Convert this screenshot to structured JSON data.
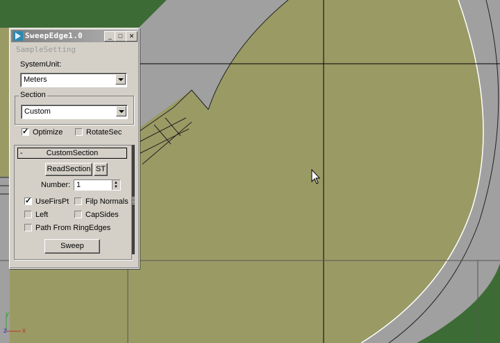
{
  "window": {
    "title": "SweepEdge1.0",
    "menu": "SampleSetting",
    "buttons": {
      "minimize": "_",
      "maximize": "□",
      "close": "✕"
    }
  },
  "system_unit": {
    "label": "SystemUnit:",
    "value": "Meters"
  },
  "section": {
    "label": "Section",
    "value": "Custom"
  },
  "options": {
    "optimize": {
      "label": "Optimize",
      "checked": true
    },
    "rotate_sec": {
      "label": "RotateSec",
      "checked": false
    }
  },
  "custom_section": {
    "header": "CustomSection",
    "collapse": "-",
    "read_section": "ReadSection",
    "st": "ST",
    "number_label": "Number:",
    "number_value": "1",
    "use_first_pt": {
      "label": "UseFirsPt",
      "checked": true
    },
    "flip_normals": {
      "label": "Filp Normals",
      "checked": false
    },
    "left": {
      "label": "Left",
      "checked": false
    },
    "cap_sides": {
      "label": "CapSides",
      "checked": false
    },
    "path_from_ring_edges": {
      "label": "Path From RingEdges",
      "checked": false
    },
    "sweep": "Sweep"
  },
  "viewport": {
    "axis_labels": {
      "y": "y",
      "z": "z",
      "x": "x"
    },
    "colors": {
      "ground": "#9a9a65",
      "road": "#a0a0a0",
      "grass": "#3d6b35",
      "road_edge": "#ffffff",
      "grid": "#000000"
    }
  }
}
